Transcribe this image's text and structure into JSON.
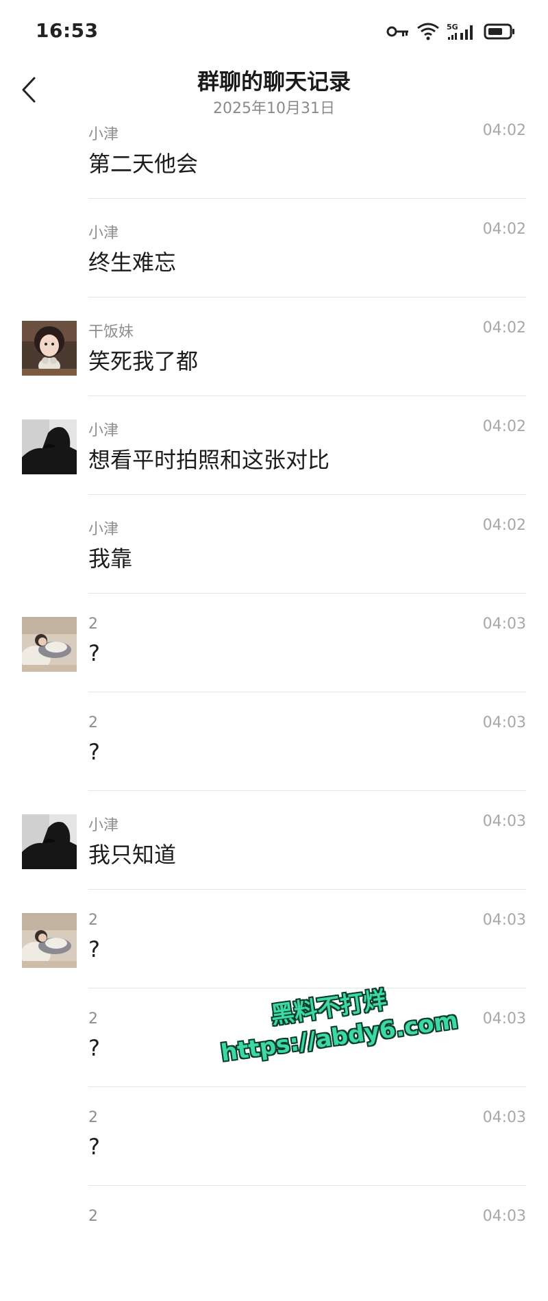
{
  "status_bar": {
    "time": "16:53",
    "icons": [
      "vpn-key-icon",
      "wifi-icon",
      "5g-signal-icon",
      "battery-icon"
    ],
    "network_label": "5G"
  },
  "header": {
    "title": "群聊的聊天记录",
    "date": "2025年10月31日",
    "back_icon": "chevron-left-icon"
  },
  "messages": [
    {
      "sender": "小津",
      "time": "04:02",
      "text": "第二天他会",
      "avatar": "none"
    },
    {
      "sender": "小津",
      "time": "04:02",
      "text": "终生难忘",
      "avatar": "none"
    },
    {
      "sender": "干饭妹",
      "time": "04:02",
      "text": "笑死我了都",
      "avatar": "girl-with-plush"
    },
    {
      "sender": "小津",
      "time": "04:02",
      "text": "想看平时拍照和这张对比",
      "avatar": "dark-silhouette"
    },
    {
      "sender": "小津",
      "time": "04:02",
      "text": "我靠",
      "avatar": "none"
    },
    {
      "sender": "2",
      "time": "04:03",
      "text": "?",
      "avatar": "person-lying"
    },
    {
      "sender": "2",
      "time": "04:03",
      "text": "?",
      "avatar": "none"
    },
    {
      "sender": "小津",
      "time": "04:03",
      "text": "我只知道",
      "avatar": "dark-silhouette"
    },
    {
      "sender": "2",
      "time": "04:03",
      "text": "?",
      "avatar": "person-lying"
    },
    {
      "sender": "2",
      "time": "04:03",
      "text": "?",
      "avatar": "none"
    },
    {
      "sender": "2",
      "time": "04:03",
      "text": "?",
      "avatar": "none"
    },
    {
      "sender": "2",
      "time": "04:03",
      "text": "",
      "avatar": "none"
    }
  ],
  "watermark": {
    "line1": "黑料不打烊",
    "line2": "https://abdy6.com",
    "color": "#3cd9a2"
  },
  "colors": {
    "background": "#ffffff",
    "sender": "#8e8e8e",
    "time": "#a8a8a8",
    "divider": "#e6e6e6"
  }
}
